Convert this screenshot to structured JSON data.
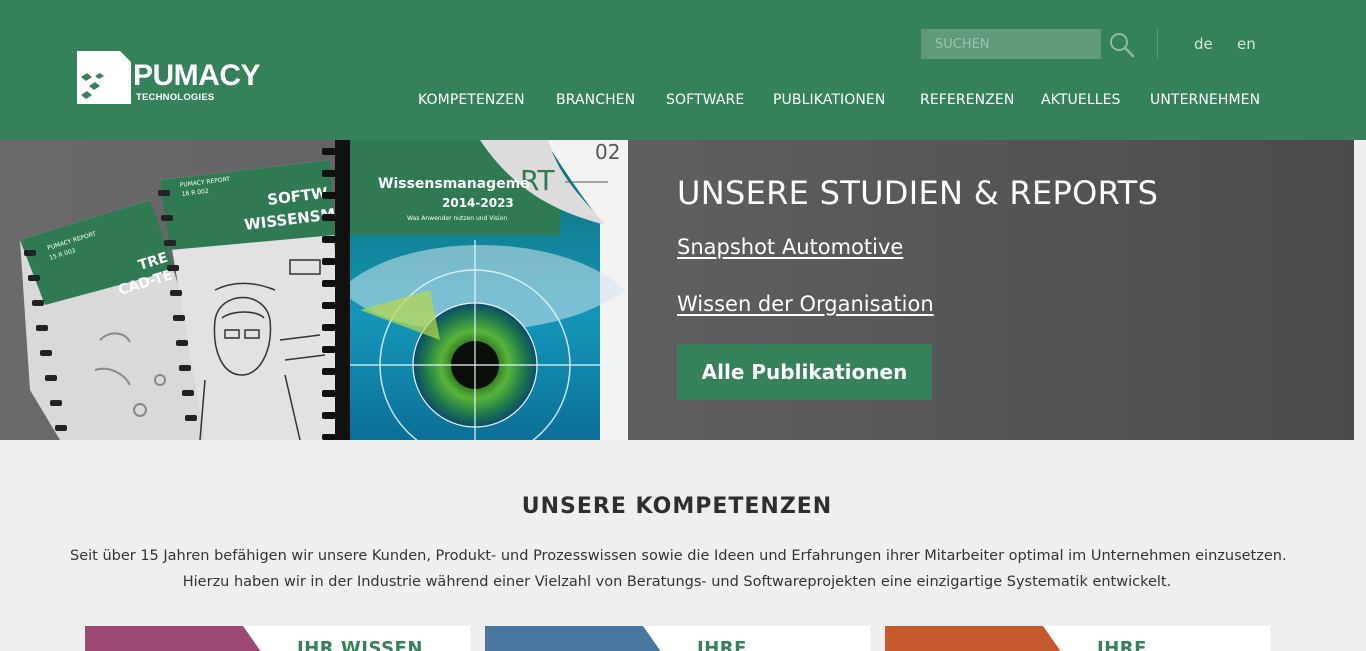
{
  "header": {
    "logo": {
      "name": "PUMACY",
      "sub": "TECHNOLOGIES"
    },
    "search": {
      "placeholder": "SUCHEN"
    },
    "languages": [
      "de",
      "en"
    ],
    "nav": [
      "KOMPETENZEN",
      "BRANCHEN",
      "SOFTWARE",
      "PUBLIKATIONEN",
      "REFERENZEN",
      "AKTUELLES",
      "UNTERNEHMEN"
    ]
  },
  "hero": {
    "title": "UNSERE STUDIEN & REPORTS",
    "links": [
      "Snapshot Automotive",
      "Wissen der Organisation"
    ],
    "button": "Alle Publikationen",
    "reports": {
      "r1_label": "PUMACY REPORT",
      "r1_code": "15 R 003",
      "r1_title_a": "TRE",
      "r1_title_b": "CAD-TE",
      "r2_label": "PUMACY REPORT",
      "r2_code": "16 R 002",
      "r2_title_a": "SOFTW",
      "r2_title_b": "WISSENSMA",
      "r3_title": "Wissensmanageme",
      "r3_years": "2014-2023",
      "r3_sub": "Was Anwender nutzen und Vision",
      "r3_number": "02",
      "r3_rt": "RT"
    }
  },
  "competences": {
    "title": "UNSERE KOMPETENZEN",
    "text": [
      "Seit über 15 Jahren befähigen wir unsere Kunden, Produkt- und Prozesswissen sowie die Ideen und Erfahrungen ihrer Mitarbeiter optimal im Unternehmen einzusetzen.",
      "Hierzu haben wir in der Industrie während einer Vielzahl von Beratungs- und Softwareprojekten eine einzigartige Systematik entwickelt."
    ],
    "cards": [
      {
        "title": "IHR WISSEN",
        "color": "#9b4b73"
      },
      {
        "title": "IHRE",
        "color": "#4a77a0"
      },
      {
        "title": "IHRE",
        "color": "#c3592c"
      }
    ]
  },
  "colors": {
    "brand_green": "#358159",
    "card_title": "#358159"
  }
}
